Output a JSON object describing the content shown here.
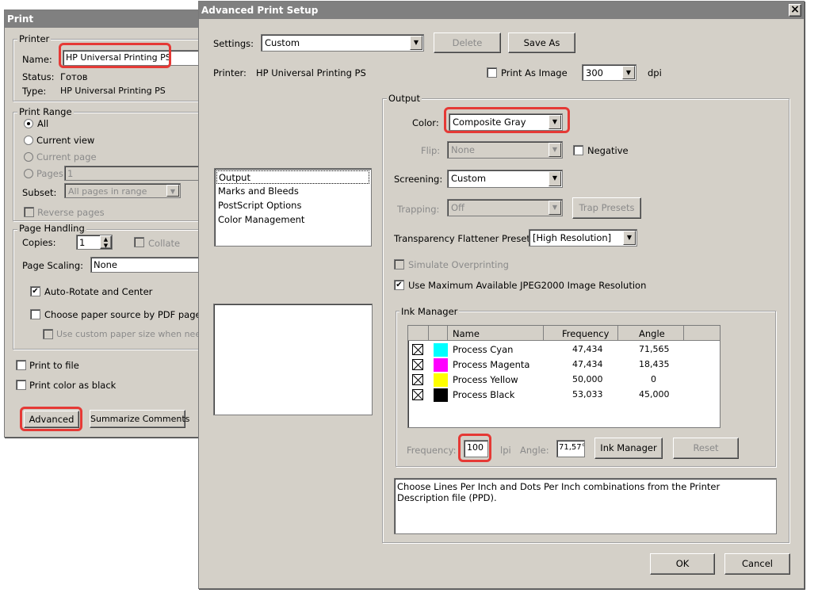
{
  "print": {
    "title": "Print",
    "printer_group": "Printer",
    "name_label": "Name:",
    "name_value": "HP Universal Printing PS",
    "status_label": "Status:",
    "status_value": "Готов",
    "type_label": "Type:",
    "type_value": "HP Universal Printing PS",
    "range_group": "Print Range",
    "range_all": "All",
    "range_current_view": "Current view",
    "range_current_page": "Current page",
    "range_pages": "Pages",
    "pages_value": "1",
    "subset_label": "Subset:",
    "subset_value": "All pages in range",
    "reverse_pages": "Reverse pages",
    "handling_group": "Page Handling",
    "copies_label": "Copies:",
    "copies_value": "1",
    "collate": "Collate",
    "scaling_label": "Page Scaling:",
    "scaling_value": "None",
    "auto_rotate": "Auto-Rotate and Center",
    "paper_source": "Choose paper source by PDF page size",
    "custom_paper": "Use custom paper size when needed",
    "print_to_file": "Print to file",
    "print_black": "Print color as black",
    "advanced_btn": "Advanced",
    "summarize_btn": "Summarize Comments"
  },
  "adv": {
    "title": "Advanced Print Setup",
    "close_glyph": "×",
    "settings_label": "Settings:",
    "settings_value": "Custom",
    "delete_btn": "Delete",
    "saveas_btn": "Save As",
    "printer_label": "Printer:",
    "printer_value": "HP Universal Printing PS",
    "print_as_image": "Print As Image",
    "dpi_value": "300",
    "dpi_label": "dpi",
    "categories": [
      "Output",
      "Marks and Bleeds",
      "PostScript Options",
      "Color Management"
    ],
    "output_group": "Output",
    "color_label": "Color:",
    "color_value": "Composite Gray",
    "flip_label": "Flip:",
    "flip_value": "None",
    "negative": "Negative",
    "screening_label": "Screening:",
    "screening_value": "Custom",
    "trapping_label": "Trapping:",
    "trapping_value": "Off",
    "trap_presets_btn": "Trap Presets",
    "flattener_label": "Transparency Flattener Preset:",
    "flattener_value": "[High Resolution]",
    "simulate_overprinting": "Simulate Overprinting",
    "jpeg2000": "Use Maximum Available JPEG2000 Image Resolution",
    "ink_group": "Ink Manager",
    "ink_headers": {
      "name": "Name",
      "frequency": "Frequency",
      "angle": "Angle"
    },
    "inks": [
      {
        "name": "Process Cyan",
        "frequency": "47,434",
        "angle": "71,565",
        "color": "#00ffff"
      },
      {
        "name": "Process Magenta",
        "frequency": "47,434",
        "angle": "18,435",
        "color": "#ff00ff"
      },
      {
        "name": "Process Yellow",
        "frequency": "50,000",
        "angle": "0",
        "color": "#ffff00"
      },
      {
        "name": "Process Black",
        "frequency": "53,033",
        "angle": "45,000",
        "color": "#000000"
      }
    ],
    "frequency_label": "Frequency:",
    "frequency_value": "100",
    "lpi_label": "lpi",
    "angle_label": "Angle:",
    "angle_value": "71,57°",
    "ink_manager_btn": "Ink Manager",
    "reset_btn": "Reset",
    "description": "Choose Lines Per Inch and Dots Per Inch combinations from the Printer Description file (PPD).",
    "ok_btn": "OK",
    "cancel_btn": "Cancel"
  },
  "colors": {
    "highlight": "#e53935",
    "title_bar": "#808080",
    "dialog_bg": "#d4d0c8"
  },
  "icons": {
    "combo_arrow": "chevron-down-icon",
    "close": "close-icon",
    "spin": "spinner-arrows-icon"
  }
}
